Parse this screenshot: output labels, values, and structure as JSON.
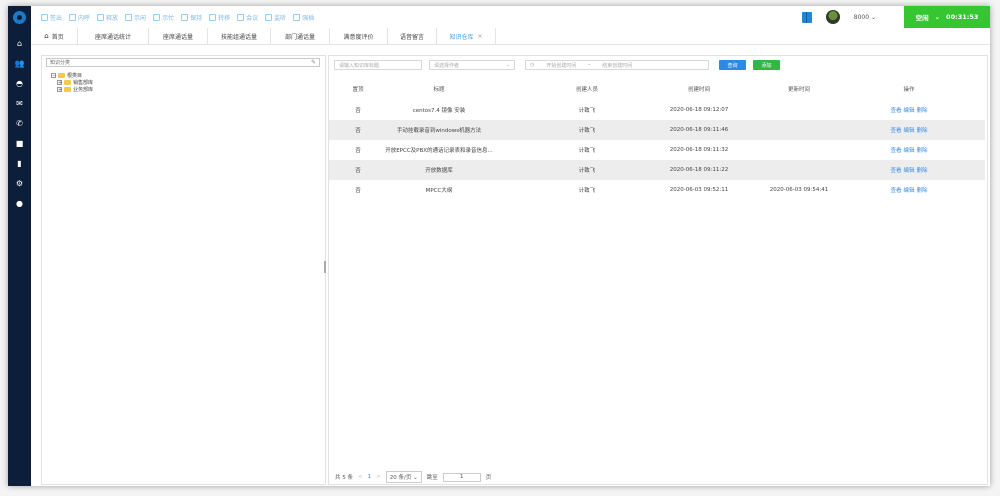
{
  "toolbar": {
    "items": [
      {
        "label": "签出",
        "icon": "edit-icon"
      },
      {
        "label": "内呼",
        "icon": "phone-icon"
      },
      {
        "label": "释放",
        "icon": "release-icon"
      },
      {
        "label": "示闲",
        "icon": "idle-icon"
      },
      {
        "label": "示忙",
        "icon": "busy-icon"
      },
      {
        "label": "保持",
        "icon": "hold-icon"
      },
      {
        "label": "转移",
        "icon": "transfer-icon"
      },
      {
        "label": "会议",
        "icon": "conference-icon"
      },
      {
        "label": "监听",
        "icon": "monitor-icon"
      },
      {
        "label": "强插",
        "icon": "insert-icon"
      }
    ]
  },
  "header": {
    "extension": "8000",
    "status_label": "空闲",
    "timer": "00:31:53"
  },
  "tabs": [
    {
      "label": "首页",
      "icon": "home-icon"
    },
    {
      "label": "座席通话统计"
    },
    {
      "label": "座席通话量"
    },
    {
      "label": "技能组通话量"
    },
    {
      "label": "部门通话量"
    },
    {
      "label": "满意度评价"
    },
    {
      "label": "语音留言"
    },
    {
      "label": "知识仓库",
      "active": true
    }
  ],
  "left_panel": {
    "search_label": "知识分类",
    "tree": [
      {
        "label": "根类目",
        "level": 0
      },
      {
        "label": "销售部库",
        "level": 1
      },
      {
        "label": "业务部库",
        "level": 1
      }
    ]
  },
  "filters": {
    "title_placeholder": "请输入知识库标题",
    "operator_placeholder": "请选择作者",
    "start_placeholder": "开始创建时间",
    "range_sep": "-",
    "end_placeholder": "结束创建时间",
    "query_label": "查询",
    "add_label": "添加"
  },
  "table": {
    "headers": [
      "置顶",
      "标题",
      "创建人员",
      "创建时间",
      "更新时间",
      "操作"
    ],
    "rows": [
      {
        "top": "否",
        "title": "centos7.4 镜像 安装",
        "creator": "计致飞",
        "created": "2020-06-18 09:12:07",
        "updated": ""
      },
      {
        "top": "否",
        "title": "手动挂载录音到windows机器方法",
        "creator": "计致飞",
        "created": "2020-06-18 09:11:46",
        "updated": ""
      },
      {
        "top": "否",
        "title": "开放EPCC及PBX的通话记录表和录音信息...",
        "creator": "计致飞",
        "created": "2020-06-18 09:11:32",
        "updated": ""
      },
      {
        "top": "否",
        "title": "开放数据库",
        "creator": "计致飞",
        "created": "2020-06-18 09:11:22",
        "updated": ""
      },
      {
        "top": "否",
        "title": "MPCC大纲",
        "creator": "计致飞",
        "created": "2020-06-03 09:52:11",
        "updated": "2020-06-03 09:54:41"
      }
    ],
    "ops": {
      "view": "查看",
      "edit": "编辑",
      "delete": "删除"
    }
  },
  "pagination": {
    "total": "共 5 条",
    "prev": "<",
    "page": "1",
    "next": ">",
    "page_size": "20 条/页",
    "goto_label": "跳至",
    "goto_value": "1",
    "page_suffix": "页"
  },
  "colors": {
    "sidebar": "#0d1e3a",
    "accent": "#3a8ee6",
    "status_green": "#35c632",
    "add_green": "#2fb845"
  }
}
